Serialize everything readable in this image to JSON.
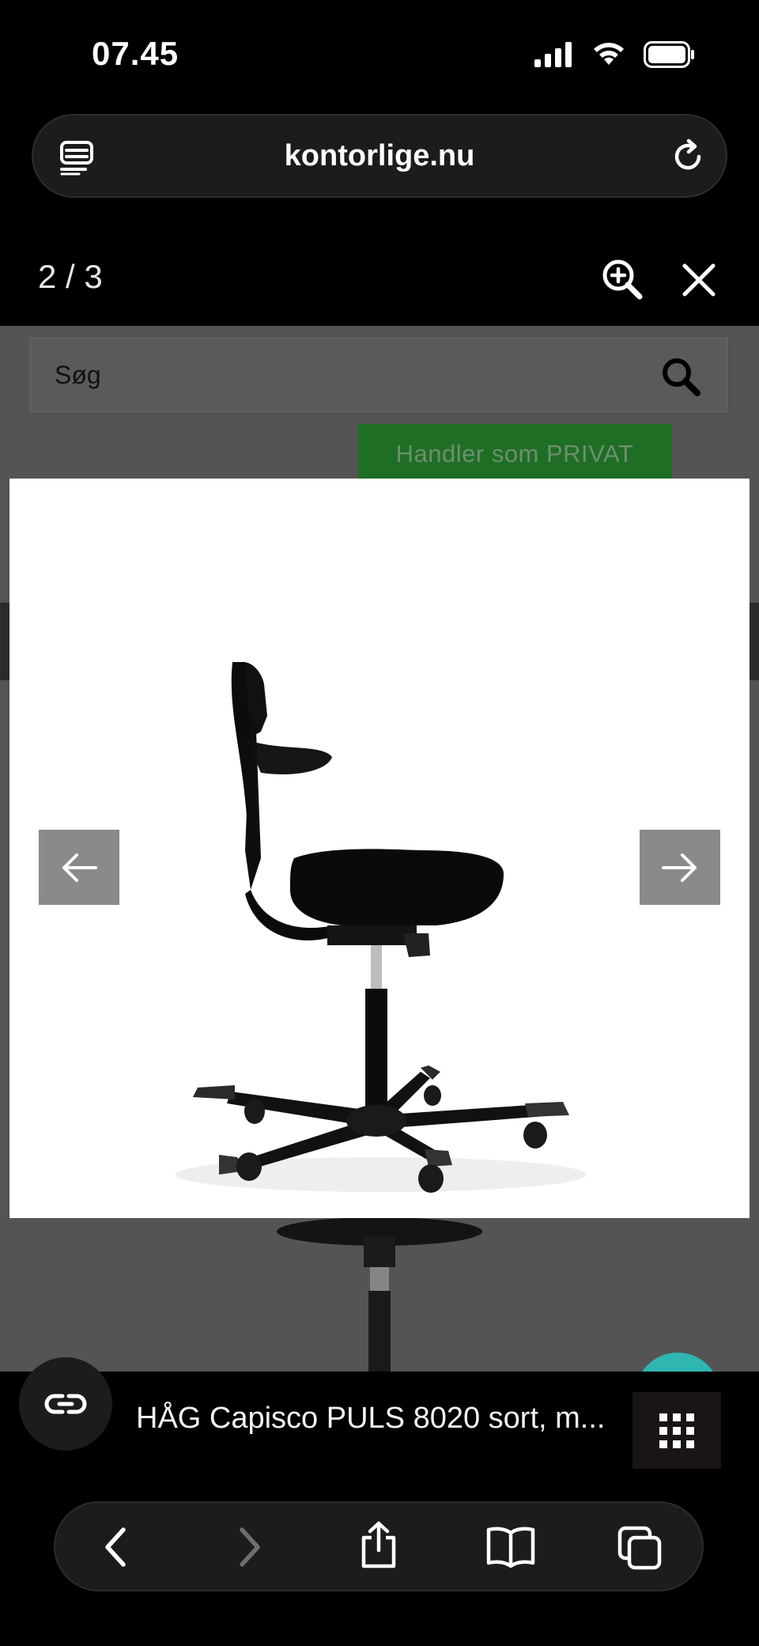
{
  "status": {
    "time": "07.45"
  },
  "browser": {
    "url": "kontorlige.nu"
  },
  "lightbox": {
    "counter": "2 / 3"
  },
  "site": {
    "search_placeholder": "Søg",
    "customer_button": "Handler som PRIVAT"
  },
  "page": {
    "title": "HÅG Capisco PULS 8020 sort, m..."
  },
  "colors": {
    "accent_teal": "#2fb6b1",
    "button_green": "#1f6e26",
    "overlay_gray": "#545454"
  },
  "icons": {
    "reader": "reader-icon",
    "reload": "reload-icon",
    "zoom": "zoom-in-icon",
    "close": "close-icon",
    "search": "search-icon",
    "prev": "arrow-left-icon",
    "next": "arrow-right-icon",
    "ai": "link-icon",
    "grid": "grid-icon",
    "back": "chevron-left-icon",
    "forward": "chevron-right-icon",
    "share": "share-icon",
    "bookmarks": "book-icon",
    "tabs": "tabs-icon"
  }
}
